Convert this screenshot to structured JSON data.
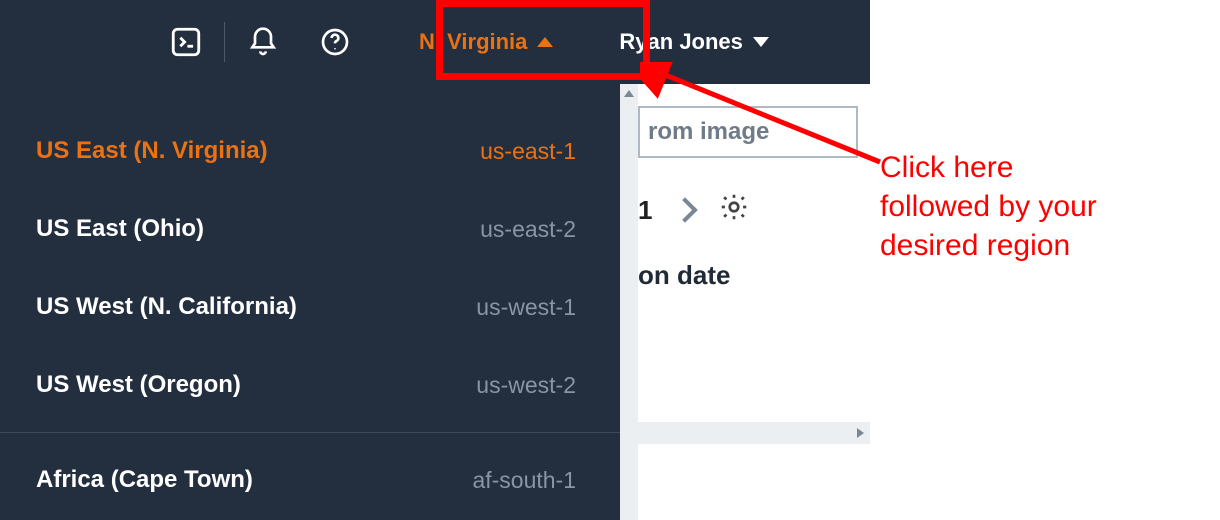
{
  "topnav": {
    "region_selected_label": "N. Virginia",
    "user_label": "Ryan Jones"
  },
  "regions": {
    "items": [
      {
        "name": "US East (N. Virginia)",
        "code": "us-east-1",
        "selected": true
      },
      {
        "name": "US East (Ohio)",
        "code": "us-east-2",
        "selected": false
      },
      {
        "name": "US West (N. California)",
        "code": "us-west-1",
        "selected": false
      },
      {
        "name": "US West (Oregon)",
        "code": "us-west-2",
        "selected": false
      },
      {
        "name": "Africa (Cape Town)",
        "code": "af-south-1",
        "selected": false
      }
    ]
  },
  "content": {
    "from_image_fragment": "rom image",
    "page_number": "1",
    "date_column_fragment": "on date"
  },
  "annotation": {
    "text_line1": "Click here",
    "text_line2": "followed by your",
    "text_line3": "desired region"
  }
}
